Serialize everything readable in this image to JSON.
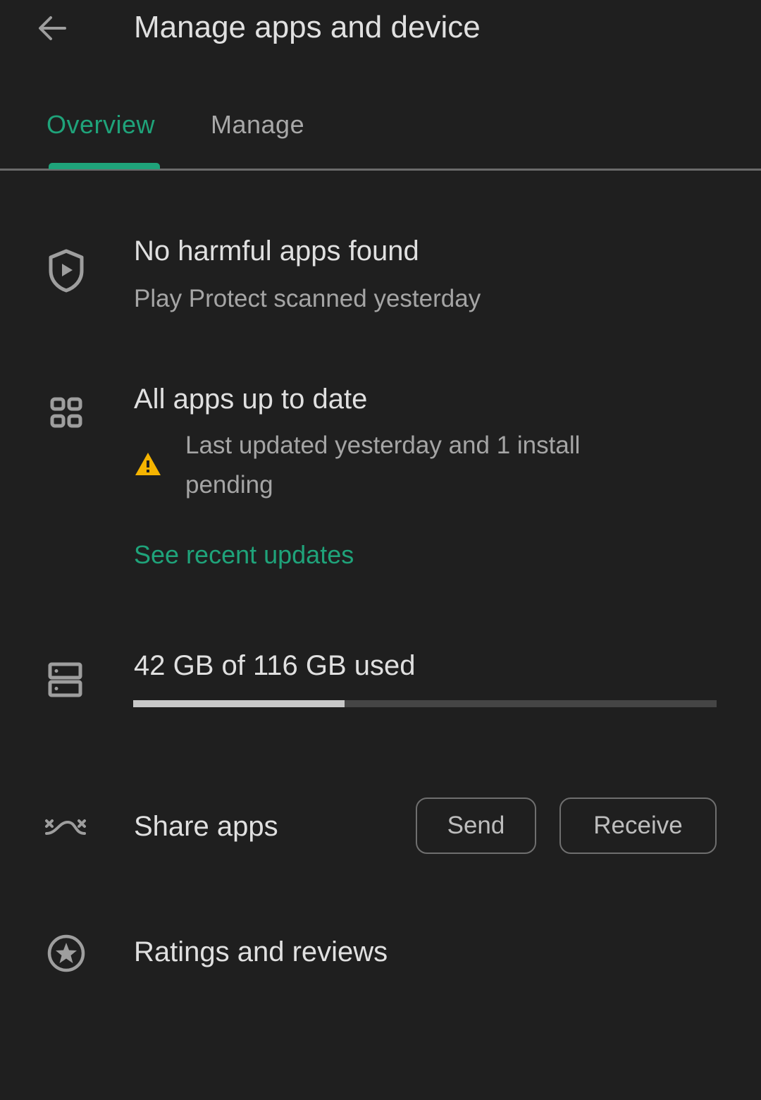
{
  "header": {
    "back_icon": "arrow-left-icon",
    "title": "Manage apps and device"
  },
  "tabs": [
    {
      "label": "Overview",
      "active": true
    },
    {
      "label": "Manage",
      "active": false
    }
  ],
  "colors": {
    "accent": "#1fa37a",
    "warning": "#f5b400",
    "background": "#1f1f1f"
  },
  "protect": {
    "icon": "shield-play-icon",
    "title": "No harmful apps found",
    "subtitle": "Play Protect scanned yesterday"
  },
  "updates": {
    "icon": "apps-grid-icon",
    "title": "All apps up to date",
    "warning_icon": "warning-triangle-icon",
    "warning_line1": "Last updated yesterday and 1 install",
    "warning_line2": "pending",
    "link": "See recent updates"
  },
  "storage": {
    "icon": "storage-icon",
    "label": "42 GB of 116 GB used",
    "used_gb": 42,
    "total_gb": 116
  },
  "share": {
    "icon": "share-apps-icon",
    "label": "Share apps",
    "send_label": "Send",
    "receive_label": "Receive"
  },
  "ratings": {
    "icon": "star-circle-icon",
    "label": "Ratings and reviews"
  }
}
